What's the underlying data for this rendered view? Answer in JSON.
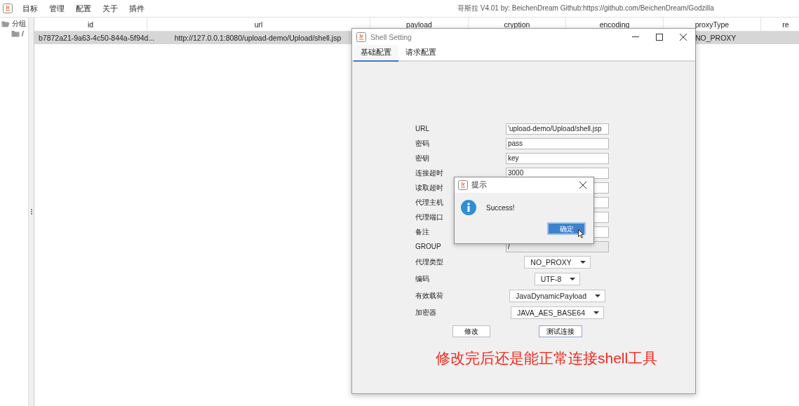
{
  "menu_bar": {
    "items": [
      "目标",
      "管理",
      "配置",
      "关于",
      "插件"
    ],
    "title": "哥斯拉   V4.01 by: BeichenDream Github:https://github.com/BeichenDream/Godzilla"
  },
  "tree": [
    {
      "label": "分组",
      "expanded": true,
      "children": [
        {
          "label": "/",
          "expanded": false
        }
      ]
    }
  ],
  "table": {
    "columns": [
      "id",
      "url",
      "payload",
      "cryption",
      "encoding",
      "proxyType",
      "re"
    ],
    "rows": [
      {
        "selected": true,
        "cells": [
          "b7872a21-9a63-4c50-844a-5f94d...",
          "http://127.0.0.1:8080/upload-demo/Upload/shell.jsp",
          null,
          null,
          null,
          "NO_PROXY",
          null
        ]
      }
    ]
  },
  "shell_setting": {
    "title": "Shell Setting",
    "tabs": [
      {
        "label": "基础配置",
        "selected": true
      },
      {
        "label": "请求配置",
        "selected": false
      }
    ],
    "fields": [
      {
        "kind": "text",
        "label": "URL",
        "value": "'upload-demo/Upload/shell.jsp",
        "disabled": false
      },
      {
        "kind": "text",
        "label": "密码",
        "value": "pass",
        "disabled": false
      },
      {
        "kind": "text",
        "label": "密钥",
        "value": "key",
        "disabled": false
      },
      {
        "kind": "text",
        "label": "连接超时",
        "value": "3000",
        "disabled": false
      },
      {
        "kind": "text",
        "label": "读取超时",
        "disabled": false
      },
      {
        "kind": "text",
        "label": "代理主机",
        "disabled": false
      },
      {
        "kind": "text",
        "label": "代理端口",
        "disabled": false
      },
      {
        "kind": "text",
        "label": "备注",
        "disabled": false
      },
      {
        "kind": "text",
        "label": "GROUP",
        "value": "/",
        "disabled": true
      },
      {
        "kind": "select",
        "label": "代理类型",
        "value": "NO_PROXY"
      },
      {
        "kind": "select",
        "label": "编码",
        "value": "UTF-8"
      },
      {
        "kind": "select",
        "label": "有效载荷",
        "value": "JavaDynamicPayload"
      },
      {
        "kind": "select",
        "label": "加密器",
        "value": "JAVA_AES_BASE64"
      }
    ],
    "buttons": [
      {
        "label": "修改",
        "focused": false
      },
      {
        "label": "测试连接",
        "focused": true
      }
    ]
  },
  "message_dialog": {
    "title": "提示",
    "message": "Success!",
    "button": "确定"
  },
  "annotation": {
    "text": "修改完后还是能正常连接shell工具"
  }
}
